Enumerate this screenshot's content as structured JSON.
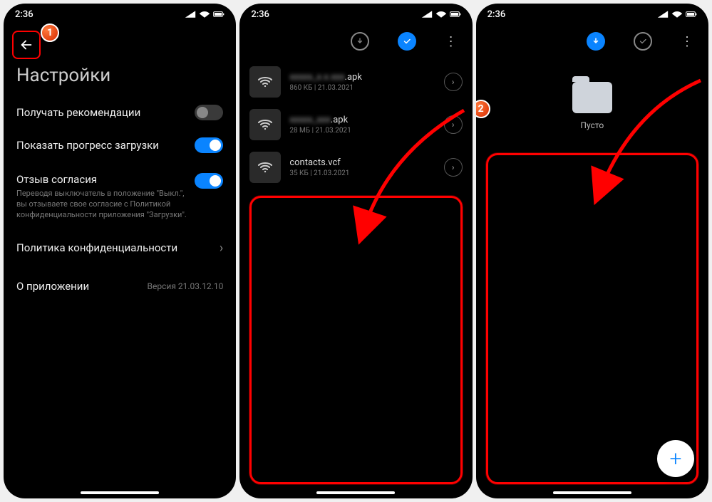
{
  "statusbar": {
    "time": "2:36"
  },
  "badges": {
    "one": "1",
    "two": "2"
  },
  "settings": {
    "title": "Настройки",
    "recommend": "Получать рекомендации",
    "progress": "Показать прогресс загрузки",
    "consent_title": "Отзыв согласия",
    "consent_sub": "Переводя выключатель в положение \"Выкл.\", вы отзываете свое согласие с Политикой конфиденциальности приложения \"Загрузки\".",
    "privacy": "Политика конфиденциальности",
    "about": "О приложении",
    "version": "Версия 21.03.12.10"
  },
  "files": [
    {
      "name_blurred": "xxxxx_x.x.xxx",
      "ext": ".apk",
      "meta": "860 КБ | 21.03.2021"
    },
    {
      "name_blurred": "xxxxx_xxx",
      "ext": ".apk",
      "meta": "28 МБ | 21.03.2021"
    },
    {
      "name": "contacts.vcf",
      "meta": "35 КБ | 21.03.2021"
    }
  ],
  "folder": {
    "label": "Пусто"
  }
}
